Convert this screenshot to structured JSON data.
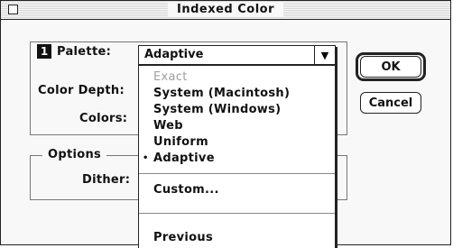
{
  "window": {
    "title": "Indexed Color"
  },
  "labels": {
    "step_number": "1",
    "palette": "Palette:",
    "color_depth": "Color Depth:",
    "colors": "Colors:",
    "options": "Options",
    "dither": "Dither:"
  },
  "palette_popup": {
    "selected": "Adaptive",
    "arrow": "▼"
  },
  "palette_menu": {
    "items": [
      {
        "label": "Exact",
        "enabled": false,
        "checked": false
      },
      {
        "label": "System (Macintosh)",
        "enabled": true,
        "checked": false
      },
      {
        "label": "System (Windows)",
        "enabled": true,
        "checked": false
      },
      {
        "label": "Web",
        "enabled": true,
        "checked": false
      },
      {
        "label": "Uniform",
        "enabled": true,
        "checked": false
      },
      {
        "label": "Adaptive",
        "enabled": true,
        "checked": true
      },
      {
        "label": "Custom...",
        "enabled": true,
        "checked": false
      },
      {
        "label": "Previous",
        "enabled": true,
        "checked": false
      }
    ],
    "check_glyph": "•"
  },
  "buttons": {
    "ok": "OK",
    "cancel": "Cancel"
  }
}
